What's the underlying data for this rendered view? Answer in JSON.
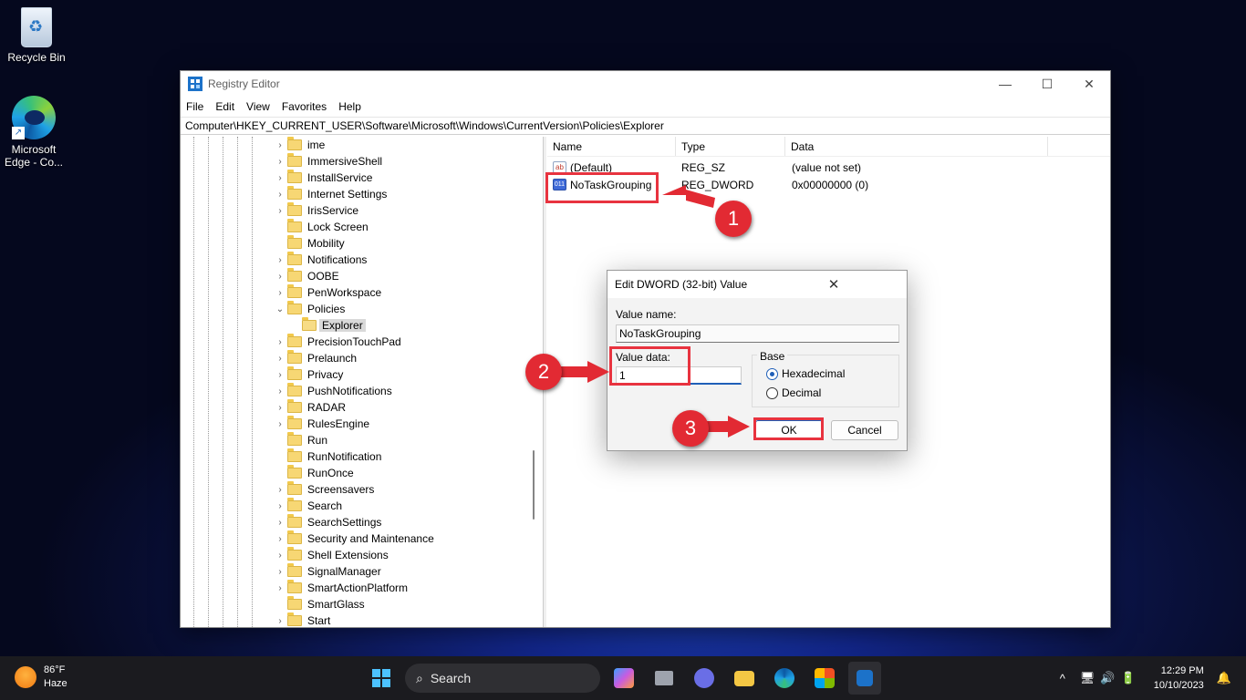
{
  "desktop": {
    "icons": [
      {
        "label": "Recycle Bin"
      },
      {
        "label": "Microsoft Edge - Co..."
      }
    ]
  },
  "window": {
    "title": "Registry Editor",
    "controls": {
      "minimize": "—",
      "maximize": "☐",
      "close": "✕"
    },
    "menu": [
      "File",
      "Edit",
      "View",
      "Favorites",
      "Help"
    ],
    "address": "Computer\\HKEY_CURRENT_USER\\Software\\Microsoft\\Windows\\CurrentVersion\\Policies\\Explorer"
  },
  "tree": {
    "items": [
      {
        "label": "ime",
        "expander": "›"
      },
      {
        "label": "ImmersiveShell",
        "expander": "›"
      },
      {
        "label": "InstallService",
        "expander": "›"
      },
      {
        "label": "Internet Settings",
        "expander": "›"
      },
      {
        "label": "IrisService",
        "expander": "›"
      },
      {
        "label": "Lock Screen",
        "expander": ""
      },
      {
        "label": "Mobility",
        "expander": ""
      },
      {
        "label": "Notifications",
        "expander": "›"
      },
      {
        "label": "OOBE",
        "expander": "›"
      },
      {
        "label": "PenWorkspace",
        "expander": "›"
      },
      {
        "label": "Policies",
        "expander": "⌄"
      },
      {
        "label": "Explorer",
        "expander": "",
        "selected": true
      },
      {
        "label": "PrecisionTouchPad",
        "expander": "›"
      },
      {
        "label": "Prelaunch",
        "expander": "›"
      },
      {
        "label": "Privacy",
        "expander": "›"
      },
      {
        "label": "PushNotifications",
        "expander": "›"
      },
      {
        "label": "RADAR",
        "expander": "›"
      },
      {
        "label": "RulesEngine",
        "expander": "›"
      },
      {
        "label": "Run",
        "expander": ""
      },
      {
        "label": "RunNotification",
        "expander": ""
      },
      {
        "label": "RunOnce",
        "expander": ""
      },
      {
        "label": "Screensavers",
        "expander": "›"
      },
      {
        "label": "Search",
        "expander": "›"
      },
      {
        "label": "SearchSettings",
        "expander": "›"
      },
      {
        "label": "Security and Maintenance",
        "expander": "›"
      },
      {
        "label": "Shell Extensions",
        "expander": "›"
      },
      {
        "label": "SignalManager",
        "expander": "›"
      },
      {
        "label": "SmartActionPlatform",
        "expander": "›"
      },
      {
        "label": "SmartGlass",
        "expander": ""
      },
      {
        "label": "Start",
        "expander": "›"
      }
    ]
  },
  "list": {
    "columns": [
      "Name",
      "Type",
      "Data"
    ],
    "rows": [
      {
        "icon": "ab",
        "name": "(Default)",
        "type": "REG_SZ",
        "data": "(value not set)"
      },
      {
        "icon": "011",
        "name": "NoTaskGrouping",
        "type": "REG_DWORD",
        "data": "0x00000000 (0)"
      }
    ]
  },
  "dialog": {
    "title": "Edit DWORD (32-bit) Value",
    "close": "✕",
    "value_name_label": "Value name:",
    "value_name": "NoTaskGrouping",
    "value_data_label": "Value data:",
    "value_data": "1",
    "base_label": "Base",
    "base_options": [
      "Hexadecimal",
      "Decimal"
    ],
    "base_selected": "Hexadecimal",
    "ok_label": "OK",
    "cancel_label": "Cancel"
  },
  "annotations": {
    "steps": [
      "1",
      "2",
      "3"
    ],
    "color": "#e22a33"
  },
  "taskbar": {
    "weather": {
      "temp": "86°F",
      "condition": "Haze"
    },
    "search_placeholder": "Search",
    "clock": {
      "time": "12:29 PM",
      "date": "10/10/2023"
    },
    "tray_chevron": "^"
  }
}
